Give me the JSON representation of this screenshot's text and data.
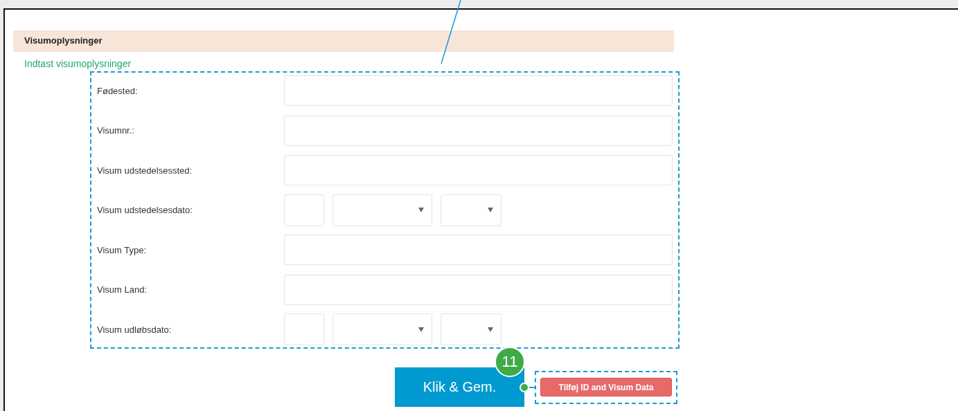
{
  "section": {
    "title": "Visumoplysninger",
    "subtitle": "Indtast visumoplysninger"
  },
  "fields": [
    {
      "kind": "text",
      "label": "Fødested:"
    },
    {
      "kind": "text",
      "label": "Visumnr.:"
    },
    {
      "kind": "text",
      "label": "Visum udstedelsessted:"
    },
    {
      "kind": "date",
      "label": "Visum udstedelsesdato:"
    },
    {
      "kind": "text",
      "label": "Visum Type:"
    },
    {
      "kind": "text",
      "label": "Visum Land:"
    },
    {
      "kind": "date",
      "label": "Visum udløbsdato:"
    }
  ],
  "callout": {
    "badge": "11",
    "action": "Klik & Gem."
  },
  "add_button": "Tilføj ID and Visum Data"
}
